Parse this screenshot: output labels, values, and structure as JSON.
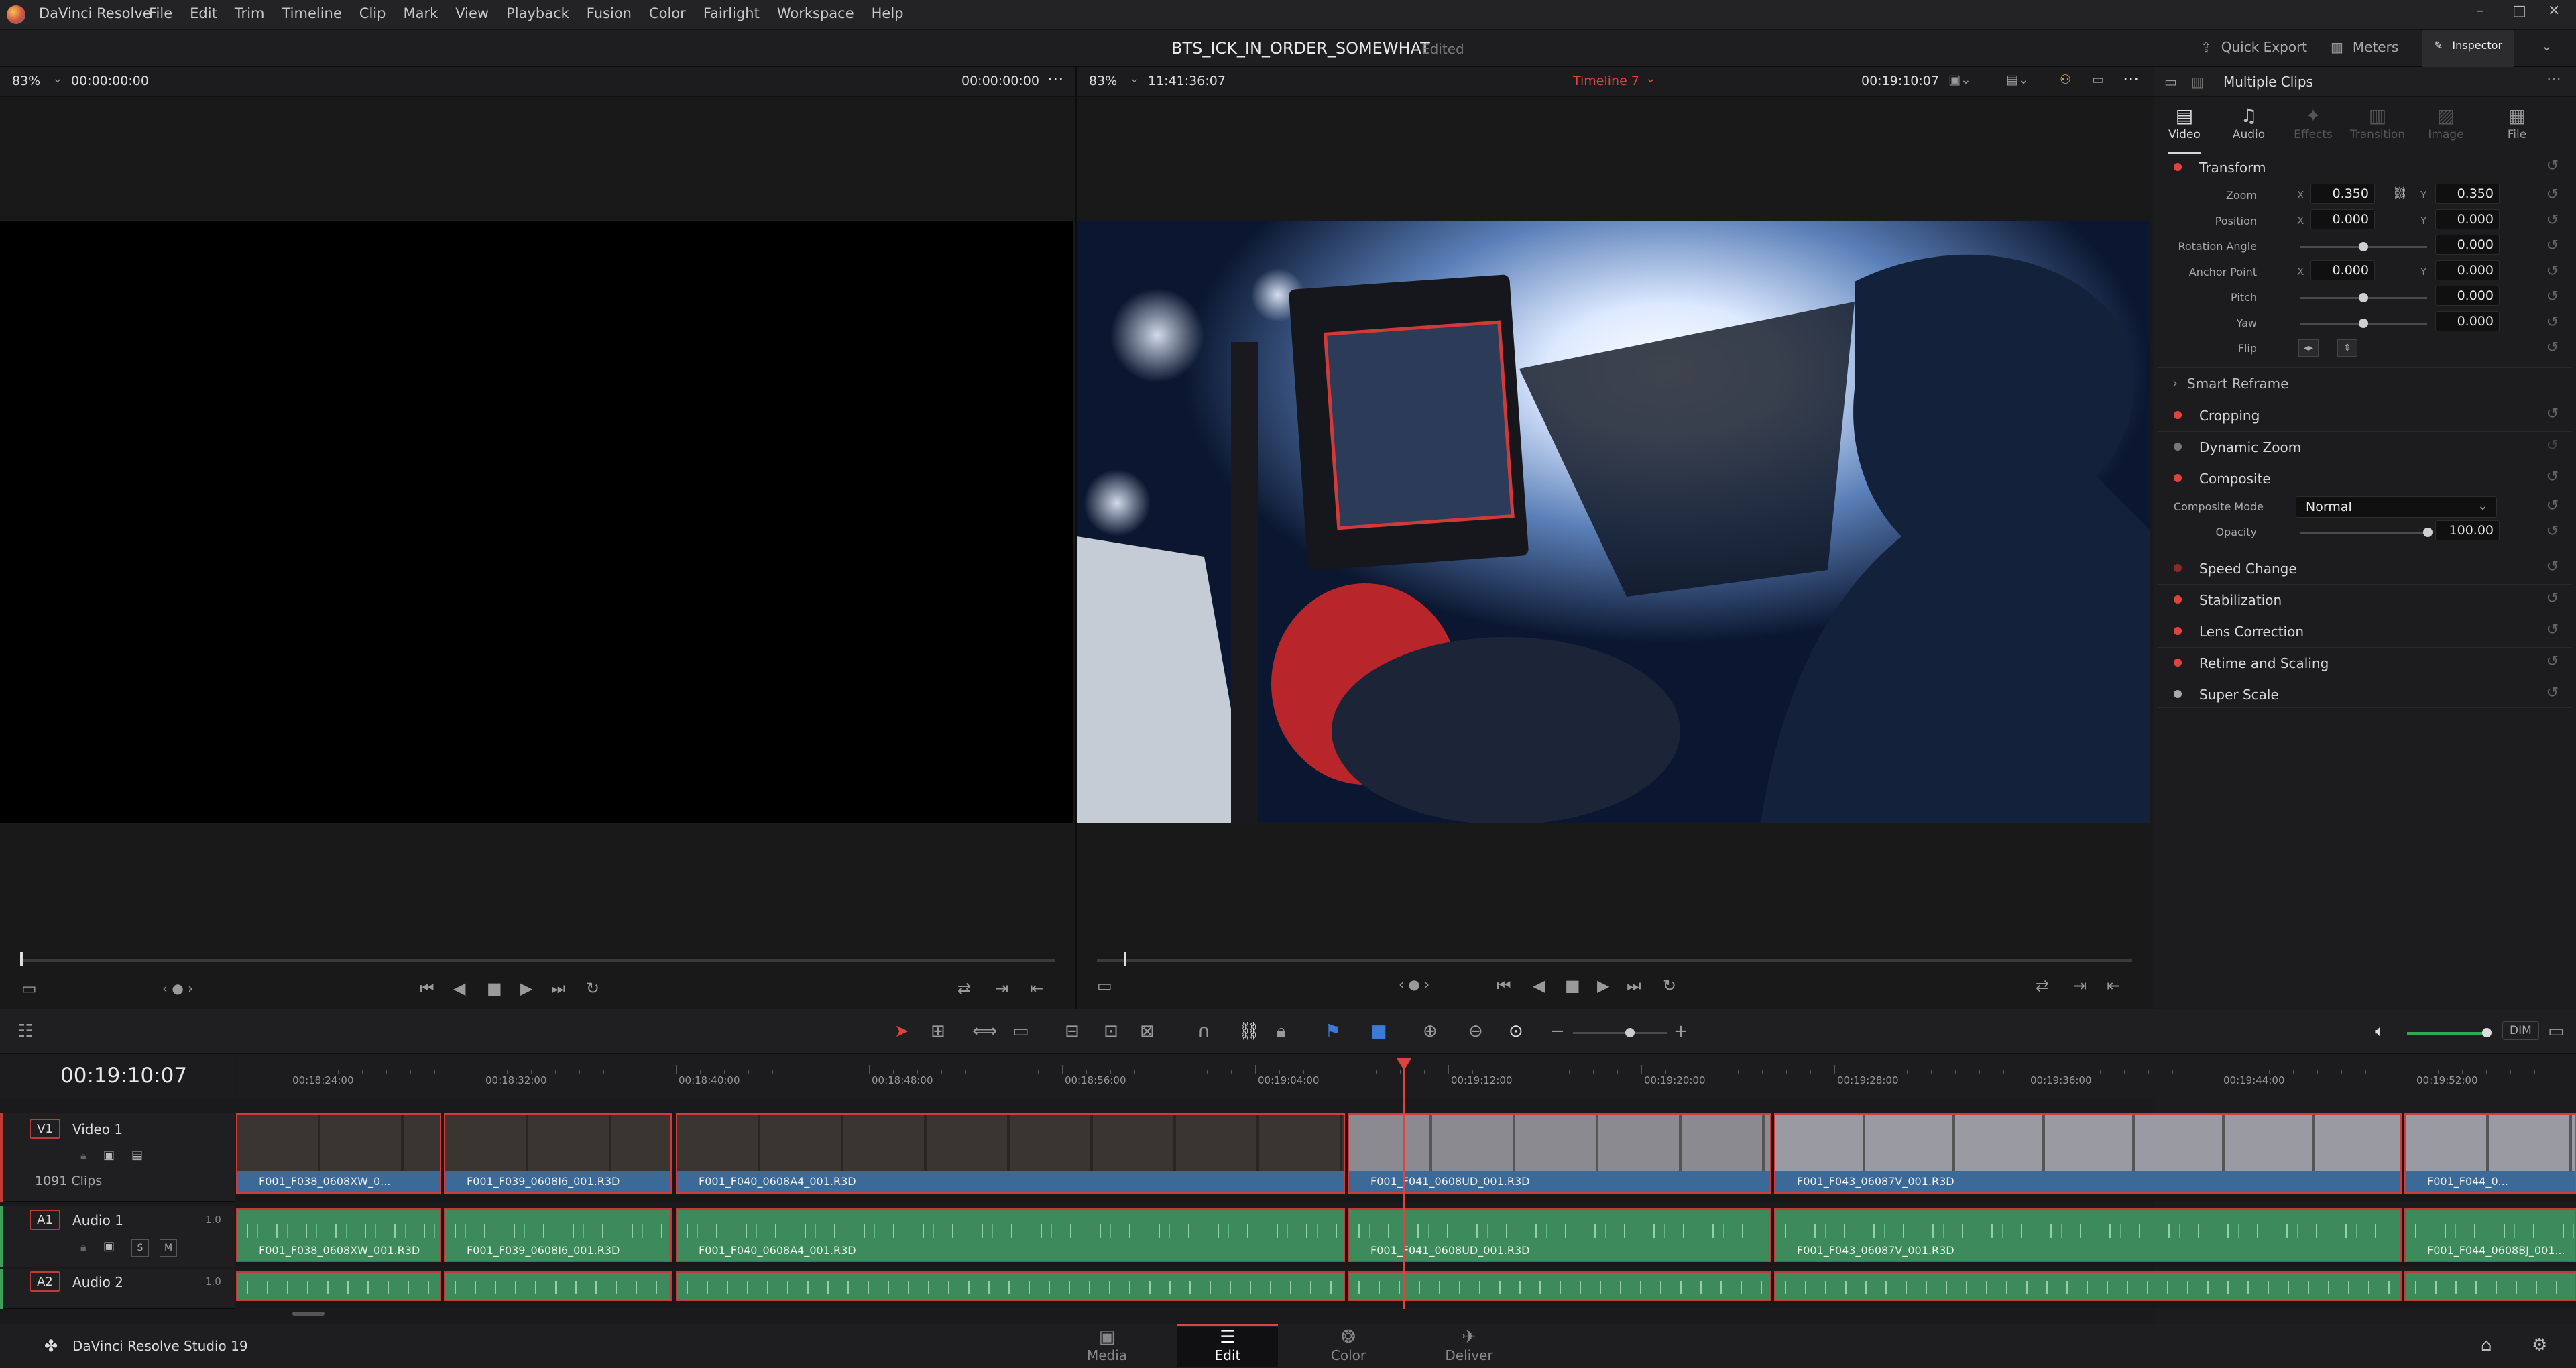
{
  "app": {
    "name": "DaVinci Resolve"
  },
  "menu": [
    "File",
    "Edit",
    "Trim",
    "Timeline",
    "Clip",
    "Mark",
    "View",
    "Playback",
    "Fusion",
    "Color",
    "Fairlight",
    "Workspace",
    "Help"
  ],
  "title": {
    "project": "BTS_ICK_IN_ORDER_SOMEWHAT",
    "status": "Edited"
  },
  "topright": {
    "quick_export": "Quick Export",
    "meters": "Meters",
    "inspector": "Inspector"
  },
  "source_viewer": {
    "zoom": "83%",
    "timecode_left": "00:00:00:00",
    "timecode_right": "00:00:00:00"
  },
  "program_viewer": {
    "zoom": "83%",
    "timecode_left": "11:41:36:07",
    "timeline_name": "Timeline 7",
    "timecode_right": "00:19:10:07"
  },
  "inspector": {
    "header": "Multiple Clips",
    "tabs": [
      "Video",
      "Audio",
      "Effects",
      "Transition",
      "Image",
      "File"
    ],
    "transform": {
      "title": "Transform",
      "zoom_label": "Zoom",
      "zoom_x": "0.350",
      "zoom_y": "0.350",
      "position_label": "Position",
      "position_x": "0.000",
      "position_y": "0.000",
      "rotation_label": "Rotation Angle",
      "rotation": "0.000",
      "anchor_label": "Anchor Point",
      "anchor_x": "0.000",
      "anchor_y": "0.000",
      "pitch_label": "Pitch",
      "pitch": "0.000",
      "yaw_label": "Yaw",
      "yaw": "0.000",
      "flip_label": "Flip"
    },
    "smart_reframe": "Smart Reframe",
    "cropping": "Cropping",
    "dynamic_zoom": "Dynamic Zoom",
    "composite": {
      "title": "Composite",
      "mode_label": "Composite Mode",
      "mode": "Normal",
      "opacity_label": "Opacity",
      "opacity": "100.00"
    },
    "sections": [
      "Speed Change",
      "Stabilization",
      "Lens Correction",
      "Retime and Scaling",
      "Super Scale"
    ],
    "xy": {
      "x": "X",
      "y": "Y"
    }
  },
  "toolbar": {
    "dim": "DIM"
  },
  "timeline": {
    "timecode": "00:19:10:07",
    "ruler": [
      "00:18:24:00",
      "00:18:32:00",
      "00:18:40:00",
      "00:18:48:00",
      "00:18:56:00",
      "00:19:04:00",
      "00:19:12:00",
      "00:19:20:00",
      "00:19:28:00",
      "00:19:36:00",
      "00:19:44:00",
      "00:19:52:00"
    ],
    "tracks": {
      "v1": {
        "tag": "V1",
        "name": "Video 1",
        "clips_count": "1091 Clips"
      },
      "a1": {
        "tag": "A1",
        "name": "Audio 1",
        "level": "1.0",
        "s": "S",
        "m": "M"
      },
      "a2": {
        "tag": "A2",
        "name": "Audio 2",
        "level": "1.0"
      }
    },
    "video_clips": [
      "F001_F038_0608XW_0...",
      "F001_F039_0608I6_001.R3D",
      "F001_F040_0608A4_001.R3D",
      "F001_F041_0608UD_001.R3D",
      "F001_F043_06087V_001.R3D",
      "F001_F044_0..."
    ],
    "audio_clips": [
      "F001_F038_0608XW_001.R3D",
      "F001_F039_0608I6_001.R3D",
      "F001_F040_0608A4_001.R3D",
      "F001_F041_0608UD_001.R3D",
      "F001_F043_06087V_001.R3D",
      "F001_F044_0608BJ_001..."
    ]
  },
  "footer": {
    "product": "DaVinci Resolve Studio 19"
  },
  "pages": [
    "Media",
    "Edit",
    "Color",
    "Deliver"
  ],
  "colors": {
    "accent_red": "#e0433e",
    "video_clip": "#3b6a98",
    "audio_clip": "#3d8a5c"
  }
}
